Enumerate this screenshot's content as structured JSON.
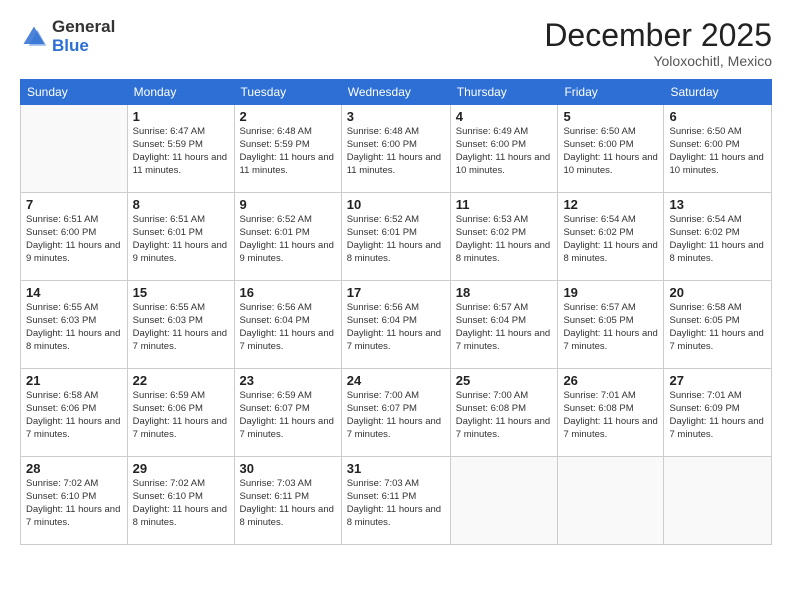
{
  "header": {
    "logo_general": "General",
    "logo_blue": "Blue",
    "month_title": "December 2025",
    "location": "Yoloxochitl, Mexico"
  },
  "days_of_week": [
    "Sunday",
    "Monday",
    "Tuesday",
    "Wednesday",
    "Thursday",
    "Friday",
    "Saturday"
  ],
  "weeks": [
    [
      {
        "day": "",
        "sunrise": "",
        "sunset": "",
        "daylight": ""
      },
      {
        "day": "1",
        "sunrise": "Sunrise: 6:47 AM",
        "sunset": "Sunset: 5:59 PM",
        "daylight": "Daylight: 11 hours and 11 minutes."
      },
      {
        "day": "2",
        "sunrise": "Sunrise: 6:48 AM",
        "sunset": "Sunset: 5:59 PM",
        "daylight": "Daylight: 11 hours and 11 minutes."
      },
      {
        "day": "3",
        "sunrise": "Sunrise: 6:48 AM",
        "sunset": "Sunset: 6:00 PM",
        "daylight": "Daylight: 11 hours and 11 minutes."
      },
      {
        "day": "4",
        "sunrise": "Sunrise: 6:49 AM",
        "sunset": "Sunset: 6:00 PM",
        "daylight": "Daylight: 11 hours and 10 minutes."
      },
      {
        "day": "5",
        "sunrise": "Sunrise: 6:50 AM",
        "sunset": "Sunset: 6:00 PM",
        "daylight": "Daylight: 11 hours and 10 minutes."
      },
      {
        "day": "6",
        "sunrise": "Sunrise: 6:50 AM",
        "sunset": "Sunset: 6:00 PM",
        "daylight": "Daylight: 11 hours and 10 minutes."
      }
    ],
    [
      {
        "day": "7",
        "sunrise": "Sunrise: 6:51 AM",
        "sunset": "Sunset: 6:00 PM",
        "daylight": "Daylight: 11 hours and 9 minutes."
      },
      {
        "day": "8",
        "sunrise": "Sunrise: 6:51 AM",
        "sunset": "Sunset: 6:01 PM",
        "daylight": "Daylight: 11 hours and 9 minutes."
      },
      {
        "day": "9",
        "sunrise": "Sunrise: 6:52 AM",
        "sunset": "Sunset: 6:01 PM",
        "daylight": "Daylight: 11 hours and 9 minutes."
      },
      {
        "day": "10",
        "sunrise": "Sunrise: 6:52 AM",
        "sunset": "Sunset: 6:01 PM",
        "daylight": "Daylight: 11 hours and 8 minutes."
      },
      {
        "day": "11",
        "sunrise": "Sunrise: 6:53 AM",
        "sunset": "Sunset: 6:02 PM",
        "daylight": "Daylight: 11 hours and 8 minutes."
      },
      {
        "day": "12",
        "sunrise": "Sunrise: 6:54 AM",
        "sunset": "Sunset: 6:02 PM",
        "daylight": "Daylight: 11 hours and 8 minutes."
      },
      {
        "day": "13",
        "sunrise": "Sunrise: 6:54 AM",
        "sunset": "Sunset: 6:02 PM",
        "daylight": "Daylight: 11 hours and 8 minutes."
      }
    ],
    [
      {
        "day": "14",
        "sunrise": "Sunrise: 6:55 AM",
        "sunset": "Sunset: 6:03 PM",
        "daylight": "Daylight: 11 hours and 8 minutes."
      },
      {
        "day": "15",
        "sunrise": "Sunrise: 6:55 AM",
        "sunset": "Sunset: 6:03 PM",
        "daylight": "Daylight: 11 hours and 7 minutes."
      },
      {
        "day": "16",
        "sunrise": "Sunrise: 6:56 AM",
        "sunset": "Sunset: 6:04 PM",
        "daylight": "Daylight: 11 hours and 7 minutes."
      },
      {
        "day": "17",
        "sunrise": "Sunrise: 6:56 AM",
        "sunset": "Sunset: 6:04 PM",
        "daylight": "Daylight: 11 hours and 7 minutes."
      },
      {
        "day": "18",
        "sunrise": "Sunrise: 6:57 AM",
        "sunset": "Sunset: 6:04 PM",
        "daylight": "Daylight: 11 hours and 7 minutes."
      },
      {
        "day": "19",
        "sunrise": "Sunrise: 6:57 AM",
        "sunset": "Sunset: 6:05 PM",
        "daylight": "Daylight: 11 hours and 7 minutes."
      },
      {
        "day": "20",
        "sunrise": "Sunrise: 6:58 AM",
        "sunset": "Sunset: 6:05 PM",
        "daylight": "Daylight: 11 hours and 7 minutes."
      }
    ],
    [
      {
        "day": "21",
        "sunrise": "Sunrise: 6:58 AM",
        "sunset": "Sunset: 6:06 PM",
        "daylight": "Daylight: 11 hours and 7 minutes."
      },
      {
        "day": "22",
        "sunrise": "Sunrise: 6:59 AM",
        "sunset": "Sunset: 6:06 PM",
        "daylight": "Daylight: 11 hours and 7 minutes."
      },
      {
        "day": "23",
        "sunrise": "Sunrise: 6:59 AM",
        "sunset": "Sunset: 6:07 PM",
        "daylight": "Daylight: 11 hours and 7 minutes."
      },
      {
        "day": "24",
        "sunrise": "Sunrise: 7:00 AM",
        "sunset": "Sunset: 6:07 PM",
        "daylight": "Daylight: 11 hours and 7 minutes."
      },
      {
        "day": "25",
        "sunrise": "Sunrise: 7:00 AM",
        "sunset": "Sunset: 6:08 PM",
        "daylight": "Daylight: 11 hours and 7 minutes."
      },
      {
        "day": "26",
        "sunrise": "Sunrise: 7:01 AM",
        "sunset": "Sunset: 6:08 PM",
        "daylight": "Daylight: 11 hours and 7 minutes."
      },
      {
        "day": "27",
        "sunrise": "Sunrise: 7:01 AM",
        "sunset": "Sunset: 6:09 PM",
        "daylight": "Daylight: 11 hours and 7 minutes."
      }
    ],
    [
      {
        "day": "28",
        "sunrise": "Sunrise: 7:02 AM",
        "sunset": "Sunset: 6:10 PM",
        "daylight": "Daylight: 11 hours and 7 minutes."
      },
      {
        "day": "29",
        "sunrise": "Sunrise: 7:02 AM",
        "sunset": "Sunset: 6:10 PM",
        "daylight": "Daylight: 11 hours and 8 minutes."
      },
      {
        "day": "30",
        "sunrise": "Sunrise: 7:03 AM",
        "sunset": "Sunset: 6:11 PM",
        "daylight": "Daylight: 11 hours and 8 minutes."
      },
      {
        "day": "31",
        "sunrise": "Sunrise: 7:03 AM",
        "sunset": "Sunset: 6:11 PM",
        "daylight": "Daylight: 11 hours and 8 minutes."
      },
      {
        "day": "",
        "sunrise": "",
        "sunset": "",
        "daylight": ""
      },
      {
        "day": "",
        "sunrise": "",
        "sunset": "",
        "daylight": ""
      },
      {
        "day": "",
        "sunrise": "",
        "sunset": "",
        "daylight": ""
      }
    ]
  ]
}
